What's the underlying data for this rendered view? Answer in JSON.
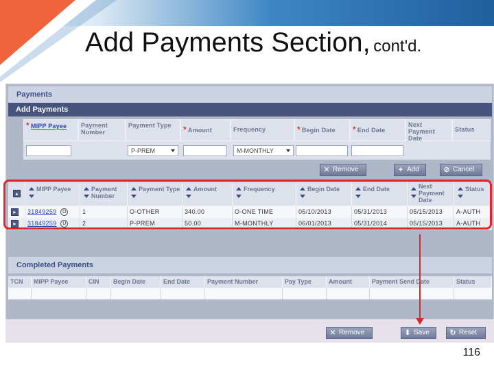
{
  "slide": {
    "title_main": "Add Payments Section,",
    "title_sub": "cont'd.",
    "page_number": "116"
  },
  "colors": {
    "accent_orange": "#f0643c",
    "accent_blue": "#2f79b8",
    "highlight_red": "#e0242c",
    "bar_navy": "#46537a"
  },
  "payments_panel": {
    "title": "Payments"
  },
  "add_payments": {
    "title": "Add Payments",
    "headers": {
      "mipp_payee": "MIPP Payee",
      "payment_number": "Payment Number",
      "payment_type": "Payment Type",
      "amount": "Amount",
      "frequency": "Frequency",
      "begin_date": "Begin Date",
      "end_date": "End Date",
      "next_payment_date": "Next Payment Date",
      "status": "Status"
    },
    "required_mark": "*",
    "inputs": {
      "payment_type_selected": "P-PREM",
      "frequency_selected": "M-MONTHLY"
    },
    "buttons": {
      "remove": "Remove",
      "add": "Add",
      "cancel": "Cancel"
    }
  },
  "payments_table": {
    "headers": {
      "mipp_payee": "MIPP Payee",
      "payment_number": "Payment Number",
      "payment_type": "Payment Type",
      "amount": "Amount",
      "frequency": "Frequency",
      "begin_date": "Begin Date",
      "end_date": "End Date",
      "next_payment_date": "Next Payment Date",
      "status": "Status"
    },
    "rows": [
      {
        "payee": "31849259",
        "type_icon": "O",
        "payment_number": "1",
        "payment_type": "O-OTHER",
        "amount": "340.00",
        "frequency": "O-ONE TIME",
        "begin_date": "05/10/2013",
        "end_date": "05/31/2013",
        "next_payment_date": "05/15/2013",
        "status": "A-AUTH"
      },
      {
        "payee": "31849259",
        "type_icon": "U",
        "payment_number": "2",
        "payment_type": "P-PREM",
        "amount": "50.00",
        "frequency": "M-MONTHLY",
        "begin_date": "06/01/2013",
        "end_date": "05/31/2014",
        "next_payment_date": "05/15/2013",
        "status": "A-AUTH"
      }
    ]
  },
  "completed_payments": {
    "title": "Completed Payments",
    "headers": {
      "tcn": "TCN",
      "mipp_payee": "MIPP Payee",
      "cin": "CIN",
      "begin_date": "Begin Date",
      "end_date": "End Date",
      "payment_number": "Payment Number",
      "pay_type": "Pay Type",
      "amount": "Amount",
      "payment_send_date": "Payment Send Date",
      "status": "Status"
    }
  },
  "footer_buttons": {
    "remove": "Remove",
    "save": "Save",
    "reset": "Reset"
  }
}
